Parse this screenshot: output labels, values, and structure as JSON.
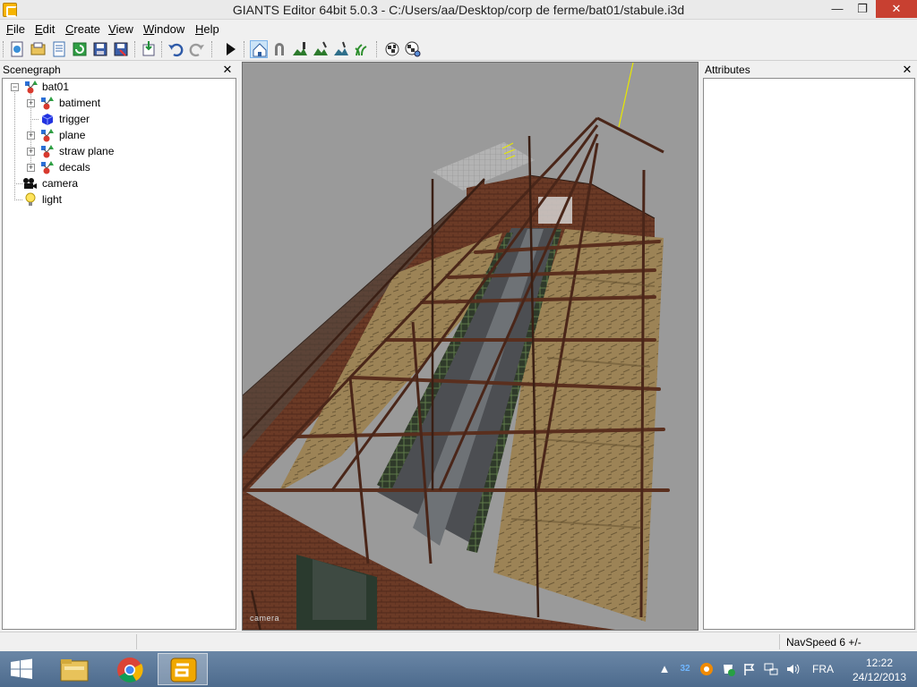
{
  "window": {
    "title": "GIANTS Editor 64bit 5.0.3 - C:/Users/aa/Desktop/corp de ferme/bat01/stabule.i3d",
    "controls": {
      "minimize": "—",
      "maximize": "❐",
      "close": "✕"
    }
  },
  "menu": [
    {
      "u": "F",
      "rest": "ile"
    },
    {
      "u": "E",
      "rest": "dit"
    },
    {
      "u": "C",
      "rest": "reate"
    },
    {
      "u": "V",
      "rest": "iew"
    },
    {
      "u": "W",
      "rest": "indow"
    },
    {
      "u": "H",
      "rest": "elp"
    }
  ],
  "toolbar": {
    "buttons": [
      "new-file-icon",
      "open-file-icon",
      "open-list-icon",
      "refresh-icon",
      "save-icon",
      "save-as-icon",
      "import-icon",
      "undo-icon",
      "redo-icon",
      "play-icon",
      "home-select-icon",
      "magnet-icon",
      "terrain-paint-icon",
      "terrain-sculpt-icon",
      "terrain-smooth-icon",
      "foliage-paint-icon",
      "checker-icon",
      "checker-settings-icon"
    ],
    "active": "home-select-icon"
  },
  "scenegraph": {
    "title": "Scenegraph",
    "close": "✕",
    "nodes": [
      {
        "label": "bat01",
        "icon": "transform-group-icon",
        "level": 0,
        "expander": "−"
      },
      {
        "label": "batiment",
        "icon": "transform-group-icon",
        "level": 1,
        "expander": "+"
      },
      {
        "label": "trigger",
        "icon": "shape-cube-icon",
        "level": 1,
        "expander": ""
      },
      {
        "label": "plane",
        "icon": "transform-group-icon",
        "level": 1,
        "expander": "+"
      },
      {
        "label": "straw plane",
        "icon": "transform-group-icon",
        "level": 1,
        "expander": "+"
      },
      {
        "label": "decals",
        "icon": "transform-group-icon",
        "level": 1,
        "expander": "+"
      },
      {
        "label": "camera",
        "icon": "camera-icon",
        "level": 0,
        "expander": ""
      },
      {
        "label": "light",
        "icon": "light-bulb-icon",
        "level": 0,
        "expander": ""
      }
    ]
  },
  "attributes": {
    "title": "Attributes",
    "close": "✕"
  },
  "viewport": {
    "camera_label": "camera"
  },
  "status": {
    "navspeed": "NavSpeed 6 +/-"
  },
  "taskbar": {
    "apps": [
      "file-explorer-icon",
      "chrome-icon",
      "giants-editor-icon"
    ],
    "active_app": "giants-editor-icon",
    "tray": {
      "language": "FRA",
      "time": "12:22",
      "date": "24/12/2013"
    }
  }
}
